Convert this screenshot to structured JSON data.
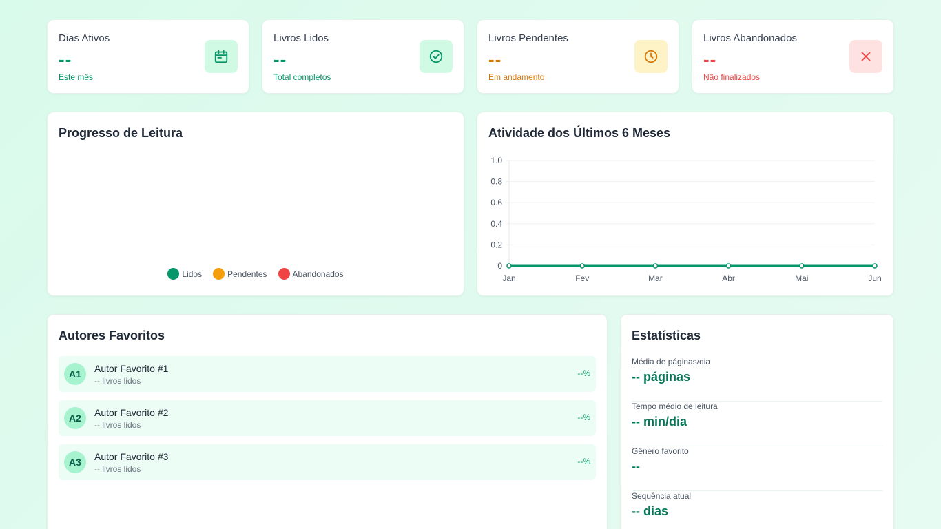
{
  "stat_cards": [
    {
      "title": "Dias Ativos",
      "value": "--",
      "subtitle": "Este mês",
      "icon": "calendar-icon",
      "color": "#059669"
    },
    {
      "title": "Livros Lidos",
      "value": "--",
      "subtitle": "Total completos",
      "icon": "check-circle-icon",
      "color": "#059669"
    },
    {
      "title": "Livros Pendentes",
      "value": "--",
      "subtitle": "Em andamento",
      "icon": "clock-icon",
      "color": "#d97706"
    },
    {
      "title": "Livros Abandonados",
      "value": "--",
      "subtitle": "Não finalizados",
      "icon": "close-icon",
      "color": "#ef4444"
    }
  ],
  "progress_card": {
    "title": "Progresso de Leitura",
    "legend": [
      {
        "label": "Lidos",
        "color": "#059669"
      },
      {
        "label": "Pendentes",
        "color": "#f59e0b"
      },
      {
        "label": "Abandonados",
        "color": "#ef4444"
      }
    ]
  },
  "activity_card": {
    "title": "Atividade dos Últimos 6 Meses"
  },
  "chart_data": {
    "type": "line",
    "title": "Atividade dos Últimos 6 Meses",
    "categories": [
      "Jan",
      "Fev",
      "Mar",
      "Abr",
      "Mai",
      "Jun"
    ],
    "series": [
      {
        "values": [
          0,
          0,
          0,
          0,
          0,
          0
        ],
        "color": "#059669"
      }
    ],
    "yticks": [
      "0",
      "0.2",
      "0.4",
      "0.6",
      "0.8",
      "1.0"
    ],
    "ylim": [
      0,
      1
    ],
    "grid": true
  },
  "authors_card": {
    "title": "Autores Favoritos",
    "items": [
      {
        "initials": "A1",
        "name": "Autor Favorito #1",
        "count": "-- livros lidos",
        "percent": "--%"
      },
      {
        "initials": "A2",
        "name": "Autor Favorito #2",
        "count": "-- livros lidos",
        "percent": "--%"
      },
      {
        "initials": "A3",
        "name": "Autor Favorito #3",
        "count": "-- livros lidos",
        "percent": "--%"
      }
    ]
  },
  "stats_card": {
    "title": "Estatísticas",
    "items": [
      {
        "label": "Média de páginas/dia",
        "value": "-- páginas"
      },
      {
        "label": "Tempo médio de leitura",
        "value": "-- min/dia"
      },
      {
        "label": "Gênero favorito",
        "value": "--"
      },
      {
        "label": "Sequência atual",
        "value": "-- dias"
      }
    ]
  }
}
